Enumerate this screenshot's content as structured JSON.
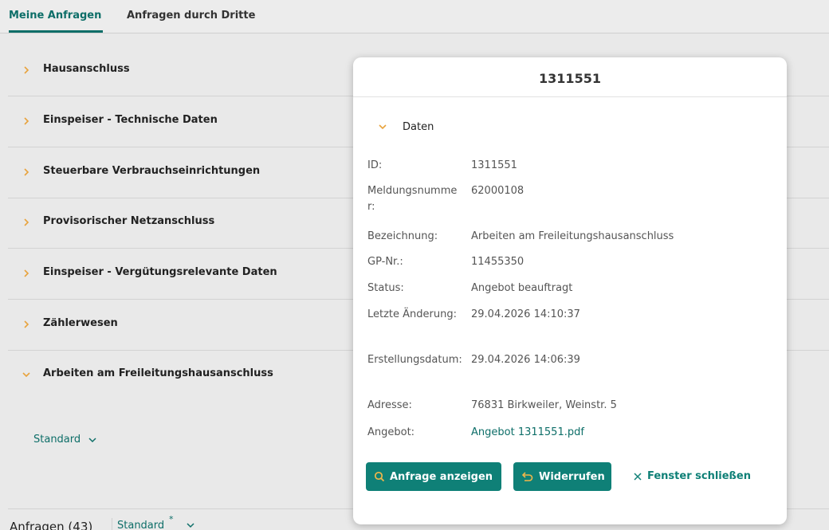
{
  "tabs": {
    "mine": "Meine Anfragen",
    "third": "Anfragen durch Dritte"
  },
  "accordion": {
    "items": [
      {
        "label": "Hausanschluss"
      },
      {
        "label": "Einspeiser - Technische Daten"
      },
      {
        "label": "Steuerbare Verbrauchseinrichtungen"
      },
      {
        "label": "Provisorischer Netzanschluss"
      },
      {
        "label": "Einspeiser - Vergütungsrelevante Daten"
      },
      {
        "label": "Zählerwesen"
      },
      {
        "label": "Arbeiten am Freileitungshausanschluss"
      }
    ],
    "view_label": "Standard"
  },
  "footer": {
    "count": "Anfragen (43)",
    "view": "Standard",
    "modified_mark": "*"
  },
  "modal": {
    "title": "1311551",
    "section": "Daten",
    "fields": {
      "id_label": "ID:",
      "id_value": "1311551",
      "msg_label": "Meldungsnummer:",
      "msg_value": "62000108",
      "desc_label": "Bezeichnung:",
      "desc_value": "Arbeiten am Freileitungshausanschluss",
      "gp_label": "GP-Nr.:",
      "gp_value": "11455350",
      "status_label": "Status:",
      "status_value": "Angebot beauftragt",
      "changed_label": "Letzte Änderung:",
      "changed_value": "29.04.2026 14:10:37",
      "created_label": "Erstellungsdatum:",
      "created_value": "29.04.2026 14:06:39",
      "address_label": "Adresse:",
      "address_value": "76831 Birkweiler, Weinstr. 5",
      "offer_label": "Angebot:",
      "offer_value": "Angebot 1311551.pdf"
    },
    "buttons": {
      "show": "Anfrage anzeigen",
      "revoke": "Widerrufen",
      "close": "Fenster schließen"
    }
  },
  "colors": {
    "accent": "#0f8077",
    "chevron": "#e8a33d"
  }
}
